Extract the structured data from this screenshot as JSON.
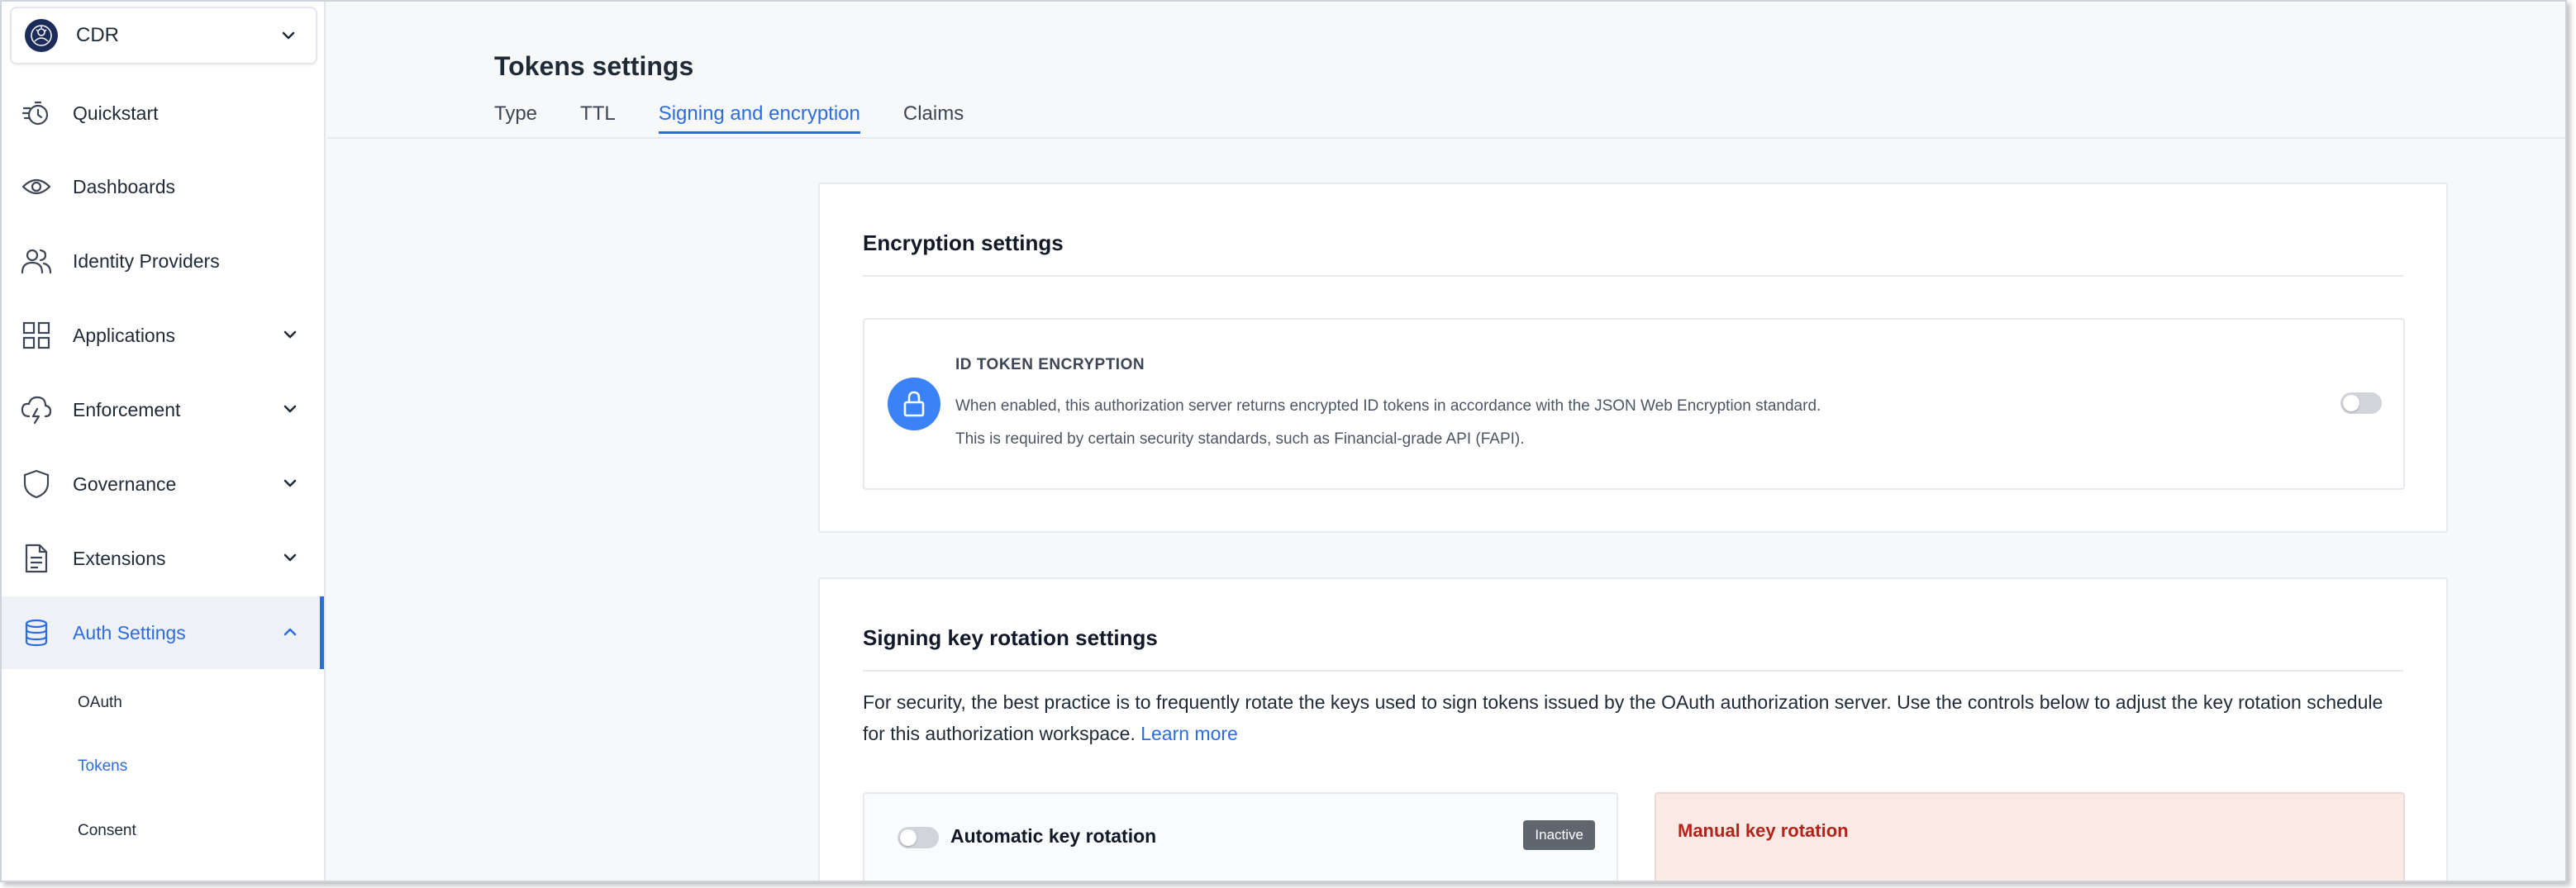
{
  "workspace": {
    "name": "CDR"
  },
  "sidebar": {
    "items": [
      {
        "label": "Quickstart",
        "icon": "quickstart-icon"
      },
      {
        "label": "Dashboards",
        "icon": "eye-icon"
      },
      {
        "label": "Identity Providers",
        "icon": "users-icon"
      },
      {
        "label": "Applications",
        "icon": "grid-icon"
      },
      {
        "label": "Enforcement",
        "icon": "lightning-cloud-icon"
      },
      {
        "label": "Governance",
        "icon": "shield-icon"
      },
      {
        "label": "Extensions",
        "icon": "document-icon"
      },
      {
        "label": "Auth Settings",
        "icon": "database-icon"
      }
    ],
    "sub_items": [
      {
        "label": "OAuth"
      },
      {
        "label": "Tokens"
      },
      {
        "label": "Consent"
      }
    ]
  },
  "page": {
    "title": "Tokens settings",
    "tabs": [
      {
        "label": "Type"
      },
      {
        "label": "TTL"
      },
      {
        "label": "Signing and encryption"
      },
      {
        "label": "Claims"
      }
    ],
    "active_tab": "Signing and encryption"
  },
  "encryption": {
    "title": "Encryption settings",
    "id_token": {
      "heading": "ID TOKEN ENCRYPTION",
      "description_line1": "When enabled, this authorization server returns encrypted ID tokens in accordance with the JSON Web Encryption standard.",
      "description_line2": "This is required by certain security standards, such as Financial-grade API (FAPI).",
      "enabled": false
    }
  },
  "rotation": {
    "title": "Signing key rotation settings",
    "description": "For security, the best practice is to frequently rotate the keys used to sign tokens issued by the OAuth authorization server. Use the controls below to adjust the key rotation schedule for this authorization workspace.",
    "learn_more": "Learn more",
    "automatic": {
      "label": "Automatic key rotation",
      "status": "Inactive",
      "enabled": false
    },
    "manual": {
      "label": "Manual key rotation"
    }
  },
  "colors": {
    "accent": "#2d6cdf",
    "manual_bg": "#fbe9e6",
    "manual_text": "#b42318",
    "badge_bg": "#5f6670"
  }
}
